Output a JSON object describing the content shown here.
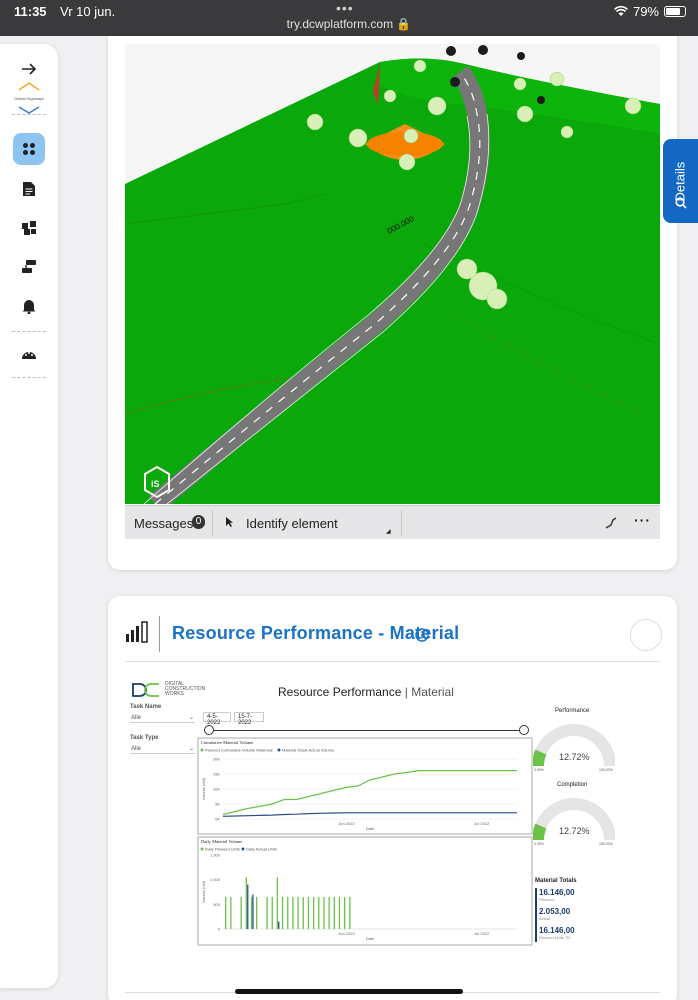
{
  "status_bar": {
    "time": "11:35",
    "date": "Vr 10 jun.",
    "url": "try.dcwplatform.com",
    "battery": "79%",
    "battery_level": 0.79
  },
  "sidebar": {
    "logo_text": "Global Highways",
    "items": [
      {
        "icon": "expand-arrow-icon"
      },
      {
        "icon": "dashboard-grid-icon",
        "active": true
      },
      {
        "icon": "document-icon"
      },
      {
        "icon": "puzzle-icon"
      },
      {
        "icon": "workflow-icon"
      },
      {
        "icon": "alarm-bell-icon"
      },
      {
        "icon": "gauge-icon"
      }
    ]
  },
  "viewer": {
    "chainage_label": "000.000",
    "badge": "iS",
    "toolbar": {
      "messages_label": "Messages",
      "messages_count": "0",
      "identify_label": "Identify element"
    },
    "details_tab": "Details"
  },
  "resource_panel": {
    "title": "Resource Performance - Material",
    "report": {
      "logo_line1": "DIGITAL",
      "logo_line2": "CONSTRUCTION",
      "logo_line3": "WORKS",
      "heading_main": "Resource Performance",
      "heading_sep": "|",
      "heading_sub": "Material",
      "filters": [
        {
          "label": "Task Name",
          "value": "Alle"
        },
        {
          "label": "Task Type",
          "value": "Alle"
        }
      ],
      "date_from": "4-5-2022",
      "date_to": "15-7-2022",
      "performance_label": "Performance",
      "performance_value": "12.72%",
      "performance_min": "0.00%",
      "performance_max": "100.00%",
      "completion_label": "Completion",
      "completion_value": "12.72%",
      "completion_min": "0.00%",
      "completion_max": "100.00%",
      "totals_label": "Material Totals",
      "totals": [
        {
          "value": "16.146,00",
          "label": "Planned"
        },
        {
          "value": "2.053,00",
          "label": "Actual"
        },
        {
          "value": "16.146,00",
          "label": "Planned Units TD"
        }
      ]
    }
  },
  "chart_data": [
    {
      "type": "line",
      "title": "Cumulative Material Volume",
      "xlabel": "Date",
      "ylabel": "Volume (m3)",
      "x_ticks": [
        "Jun 2022",
        "Jul 2022"
      ],
      "y_ticks": [
        "0K",
        "5K",
        "10K",
        "15K",
        "20K"
      ],
      "ylim": [
        0,
        20000
      ],
      "series": [
        {
          "name": "Planned Cumulative Volume Materials",
          "color": "#6cc24a",
          "values": [
            1500,
            2500,
            3500,
            4200,
            5000,
            6500,
            6500,
            7500,
            8500,
            9500,
            10500,
            11000,
            13000,
            14000,
            15000,
            15500,
            16146,
            16146,
            16146,
            16146,
            16146,
            16146,
            16146,
            16146,
            16146
          ]
        },
        {
          "name": "Material Totals Actual Volume",
          "color": "#2d4d8a",
          "values": [
            900,
            1000,
            1100,
            1200,
            1300,
            1500,
            1600,
            1800,
            1900,
            2000,
            2053,
            2053,
            2053,
            2053,
            2053,
            2053,
            2053,
            2053,
            2053,
            2053,
            2053,
            2053,
            2053,
            2053,
            2053
          ]
        }
      ]
    },
    {
      "type": "bar",
      "title": "Daily Material Volume",
      "xlabel": "Date",
      "ylabel": "Volume (m3)",
      "x_ticks": [
        "Jun 2022",
        "Jul 2022"
      ],
      "y_ticks": [
        "0",
        "500",
        "1.000",
        "1.500"
      ],
      "ylim": [
        0,
        1500
      ],
      "series": [
        {
          "name": "Daily Planned Units",
          "color": "#6cc24a",
          "values": [
            650,
            650,
            0,
            650,
            1050,
            650,
            650,
            0,
            650,
            650,
            1050,
            650,
            650,
            650,
            650,
            650,
            650,
            650,
            650,
            650,
            650,
            650,
            650,
            650,
            650
          ]
        },
        {
          "name": "Daily Actual Units",
          "color": "#2d4d8a",
          "values": [
            0,
            0,
            0,
            0,
            900,
            700,
            0,
            0,
            0,
            0,
            150,
            0,
            0,
            0,
            0,
            0,
            0,
            0,
            0,
            0,
            0,
            0,
            0,
            0,
            0
          ]
        }
      ]
    }
  ]
}
